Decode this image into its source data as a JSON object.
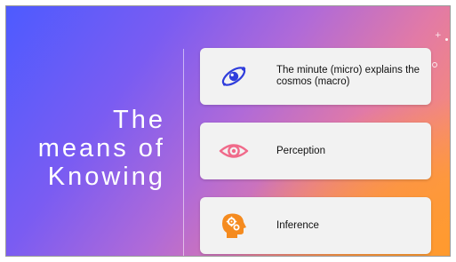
{
  "slide": {
    "title_lines": [
      "The",
      "means of",
      "Knowing"
    ],
    "cards": [
      {
        "label": "The minute (micro) explains the cosmos (macro)",
        "icon": "galaxy-orbit-icon",
        "icon_color": "#2f3ddc"
      },
      {
        "label": "Perception",
        "icon": "eye-icon",
        "icon_color": "#f06a8a"
      },
      {
        "label": "Inference",
        "icon": "head-gears-icon",
        "icon_color": "#f58b1f"
      }
    ],
    "colors": {
      "gradient_start": "#4d5bff",
      "gradient_mid": "#b06ad8",
      "gradient_end": "#ff9a2e",
      "card_background": "#f2f2f2"
    }
  }
}
